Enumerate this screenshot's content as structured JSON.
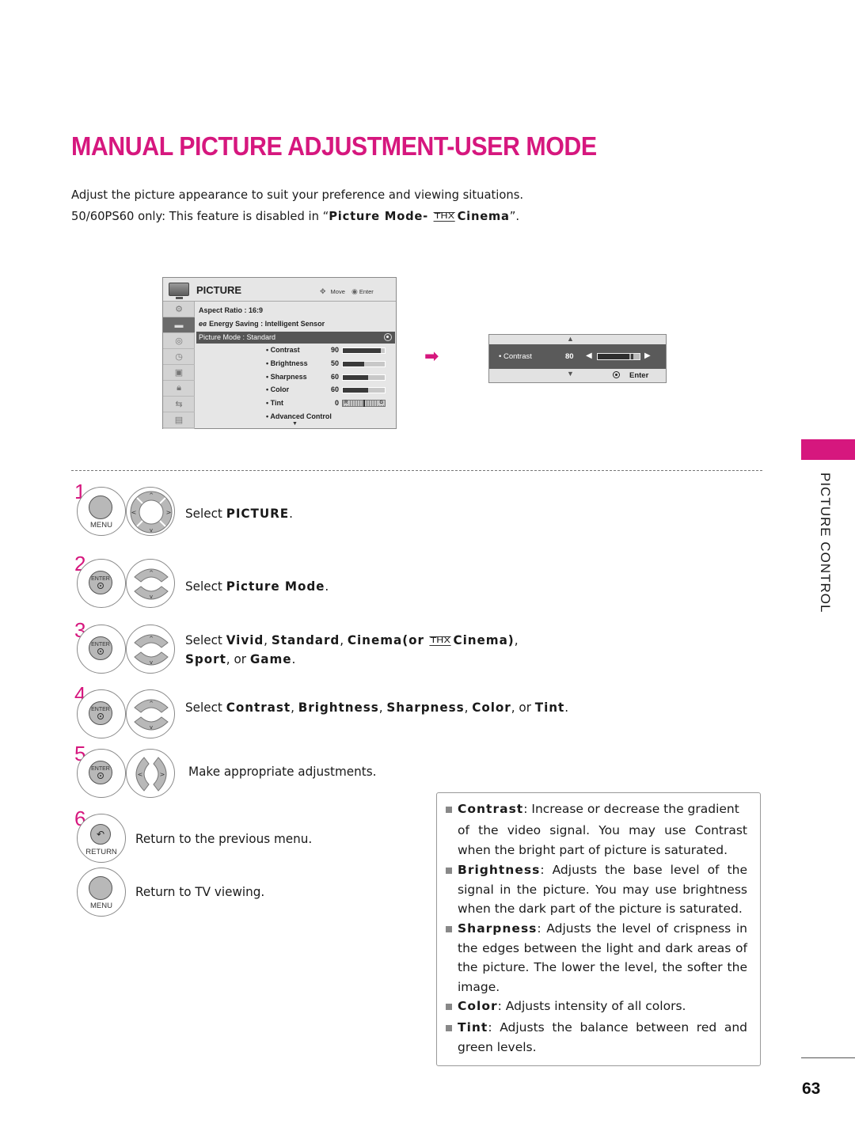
{
  "page": {
    "title": "MANUAL PICTURE ADJUSTMENT-USER MODE",
    "intro_line1": "Adjust the picture appearance to suit your preference and viewing situations.",
    "intro_line2_prefix": "50/60PS60 only: This feature is disabled in “",
    "intro_line2_bold": "Picture Mode-",
    "intro_line2_thx": "THX",
    "intro_line2_bold2": "Cinema",
    "intro_line2_suffix": "”.",
    "section_label": "PICTURE CONTROL",
    "page_number": "63",
    "accent_color": "#d6177e"
  },
  "osd_menu": {
    "title": "PICTURE",
    "hint_move": "Move",
    "hint_enter": "Enter",
    "sidebar_icons": [
      "setup-icon",
      "picture-icon",
      "audio-icon",
      "time-icon",
      "option-icon",
      "lock-icon",
      "input-icon",
      "usb-icon"
    ],
    "rows": [
      {
        "label": "Aspect Ratio    : 16:9"
      },
      {
        "label": "Energy Saving : Intelligent Sensor"
      },
      {
        "label": "Picture Mode   : Standard"
      }
    ],
    "settings": [
      {
        "name": "• Contrast",
        "value": "90",
        "level": 90
      },
      {
        "name": "• Brightness",
        "value": "50",
        "level": 50
      },
      {
        "name": "• Sharpness",
        "value": "60",
        "level": 60
      },
      {
        "name": "• Color",
        "value": "60",
        "level": 60
      },
      {
        "name": "• Tint",
        "value": "0",
        "level": 0
      }
    ],
    "tint_left": "R",
    "tint_right": "G",
    "advanced": "• Advanced Control"
  },
  "adjust_popup": {
    "name": "• Contrast",
    "value": "80",
    "level": 80,
    "enter_label": "Enter"
  },
  "steps": [
    {
      "num": "1",
      "button": "MENU",
      "text_prefix": "Select ",
      "bold": "PICTURE",
      "text_suffix": "."
    },
    {
      "num": "2",
      "button": "ENTER",
      "text_prefix": "Select ",
      "bold": "Picture Mode",
      "text_suffix": "."
    },
    {
      "num": "3",
      "button": "ENTER",
      "t1": "Select ",
      "b1": "Vivid",
      "t2": ", ",
      "b2": "Standard",
      "t3": ", ",
      "b3": "Cinema(or",
      "thx": "THX",
      "b4": "Cinema)",
      "t4": ",",
      "b5": "Sport",
      "t5": ", or ",
      "b6": "Game",
      "t6": "."
    },
    {
      "num": "4",
      "button": "ENTER",
      "t1": "Select ",
      "b1": "Contrast",
      "t2": ", ",
      "b2": "Brightness",
      "t3": ", ",
      "b3": "Sharpness",
      "t4": ", ",
      "b4": "Color",
      "t5": ", or ",
      "b5": "Tint",
      "t6": "."
    },
    {
      "num": "5",
      "button": "ENTER",
      "text": "Make appropriate adjustments."
    },
    {
      "num": "6",
      "button": "RETURN",
      "text": "Return to the previous menu."
    },
    {
      "num": "",
      "button": "MENU",
      "text": "Return to TV viewing."
    }
  ],
  "info": [
    {
      "term": "Contrast",
      "line1": ": Increase or decrease the gradient",
      "rest": "of the video signal. You may use Contrast when the bright part of picture is saturated."
    },
    {
      "term": "Brightness",
      "text": ": Adjusts the base level of the signal in the picture. You may use brightness when the dark part of the picture is saturated."
    },
    {
      "term": "Sharpness",
      "text": ": Adjusts the level of crispness in the edges between the light and dark areas of the picture. The lower the level, the softer the image."
    },
    {
      "term": "Color",
      "text": ": Adjusts intensity of all colors."
    },
    {
      "term": "Tint",
      "text": ": Adjusts the balance between red and green levels."
    }
  ]
}
